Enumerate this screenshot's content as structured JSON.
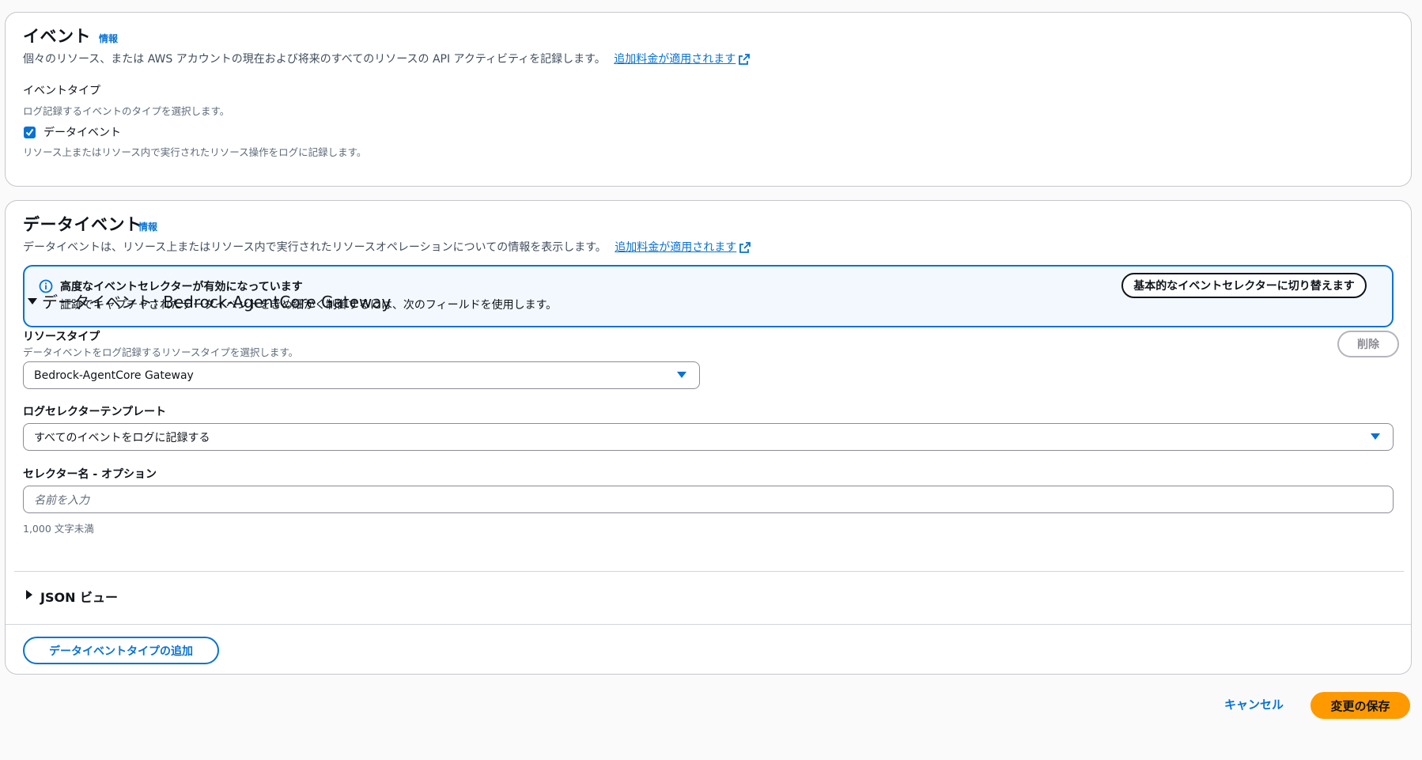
{
  "events_panel": {
    "title": "イベント",
    "info": "情報",
    "description": "個々のリソース、または AWS アカウントの現在および将来のすべてのリソースの API アクティビティを記録します。",
    "link": "追加料金が適用されます",
    "event_type_label": "イベントタイプ",
    "event_type_hint": "ログ記録するイベントのタイプを選択します。",
    "data_events_checkbox": "データイベント",
    "data_events_checked": true,
    "data_events_hint": "リソース上またはリソース内で実行されたリソース操作をログに記録します。"
  },
  "data_panel": {
    "title": "データイベント",
    "info": "情報",
    "description": "データイベントは、リソース上またはリソース内で実行されたリソースオペレーションについての情報を表示します。",
    "link": "追加料金が適用されます",
    "alert": {
      "title": "高度なイベントセレクターが有効になっています",
      "text": "証跡でキャプチャされたデータイベントをきめ細かく制御するには、次のフィールドを使用します。",
      "button": "基本的なイベントセレクターに切り替えます"
    },
    "section": {
      "title": "データイベント: Bedrock-AgentCore Gateway",
      "remove_button": "削除",
      "resource_type_label": "リソースタイプ",
      "resource_type_hint": "データイベントをログ記録するリソースタイプを選択します。",
      "resource_type_value": "Bedrock-AgentCore Gateway",
      "log_selector_label": "ログセレクターテンプレート",
      "log_selector_value": "すべてのイベントをログに記録する",
      "selector_name_label": "セレクター名 - オプション",
      "selector_name_placeholder": "名前を入力",
      "selector_name_hint": "1,000 文字未満",
      "json_view": "JSON ビュー"
    },
    "add_button": "データイベントタイプの追加"
  },
  "footer": {
    "cancel": "キャンセル",
    "save": "変更の保存"
  },
  "colors": {
    "accent": "#0972d3",
    "primary_button": "#ff9900",
    "alert_bg": "#f2f8fd"
  }
}
